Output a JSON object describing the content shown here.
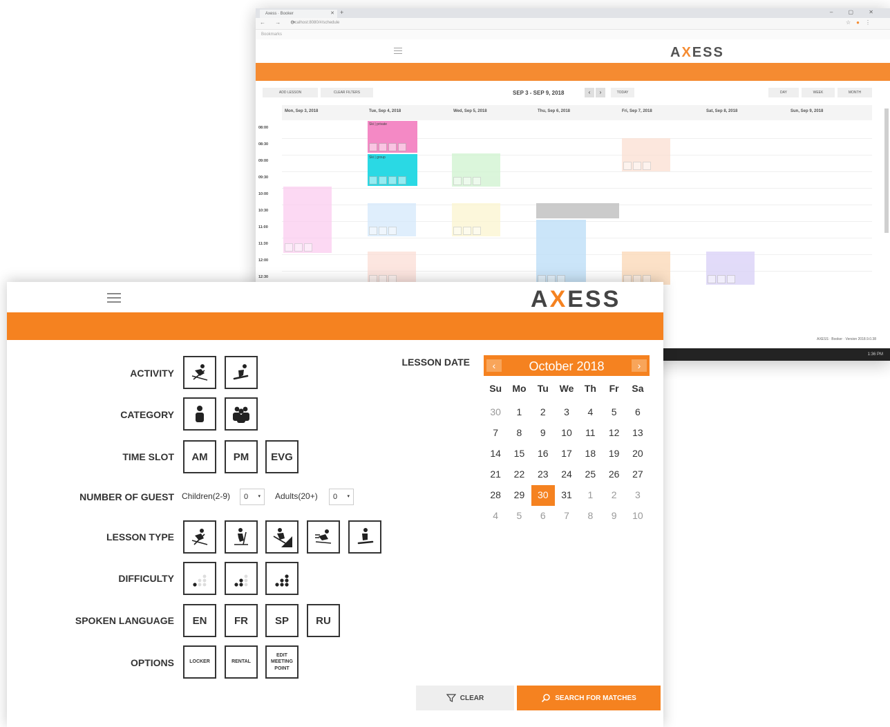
{
  "back_window": {
    "tab_title": "Axess · Booker",
    "url": "localhost:8080/#/schedule",
    "bookmark": "Bookmarks",
    "logo": "AXESS",
    "toolbar": {
      "add_label": "ADD LESSON",
      "clear_label": "CLEAR FILTERS",
      "range": "SEP 3 - SEP 9, 2018",
      "today": "TODAY",
      "day": "DAY",
      "week": "WEEK",
      "month": "MONTH"
    },
    "days": [
      "Mon, Sep 3, 2018",
      "Tue, Sep 4, 2018",
      "Wed, Sep 5, 2018",
      "Thu, Sep 6, 2018",
      "Fri, Sep 7, 2018",
      "Sat, Sep 8, 2018",
      "Sun, Sep 9, 2018"
    ],
    "times": [
      "08:00",
      "08:30",
      "09:00",
      "09:30",
      "10:00",
      "10:30",
      "11:00",
      "11:30",
      "12:00",
      "12:30"
    ],
    "appointments": [
      {
        "title": "Ski | private",
        "color": "#f47fc1"
      },
      {
        "title": "Ski | group",
        "color": "#18d6e2"
      }
    ],
    "footer": "AXESS · Booker · Version 2018.9.0.38",
    "taskbar_time": "1:36 PM"
  },
  "front_window": {
    "logo": "AXESS",
    "labels": {
      "activity": "ACTIVITY",
      "category": "CATEGORY",
      "time_slot": "TIME SLOT",
      "number_of_guest": "NUMBER OF GUEST",
      "lesson_type": "LESSON TYPE",
      "difficulty": "DIFFICULTY",
      "spoken_language": "SPOKEN LANGUAGE",
      "options": "OPTIONS",
      "lesson_date": "LESSON DATE"
    },
    "activity_icons": [
      "ski-icon",
      "snowboard-icon"
    ],
    "category_icons": [
      "single-person-icon",
      "group-icon"
    ],
    "time_slots": [
      "AM",
      "PM",
      "EVG"
    ],
    "guests": {
      "children_label": "Children(2-9)",
      "children_value": "0",
      "adults_label": "Adults(20+)",
      "adults_value": "0"
    },
    "lesson_type_icons": [
      "ski-downhill-icon",
      "cross-country-icon",
      "freestyle-icon",
      "racing-icon",
      "snowboard-trick-icon"
    ],
    "difficulty_icons": [
      "difficulty-beginner-icon",
      "difficulty-intermediate-icon",
      "difficulty-advanced-icon"
    ],
    "languages": [
      "EN",
      "FR",
      "SP",
      "RU"
    ],
    "options": [
      "LOCKER",
      "RENTAL",
      "EDIT MEETING POINT"
    ],
    "calendar": {
      "month": "October 2018",
      "prev": "‹",
      "next": "›",
      "dow": [
        "Su",
        "Mo",
        "Tu",
        "We",
        "Th",
        "Fr",
        "Sa"
      ],
      "days": [
        "30",
        "1",
        "2",
        "3",
        "4",
        "5",
        "6",
        "7",
        "8",
        "9",
        "10",
        "11",
        "12",
        "13",
        "14",
        "15",
        "16",
        "17",
        "18",
        "19",
        "20",
        "21",
        "22",
        "23",
        "24",
        "25",
        "26",
        "27",
        "28",
        "29",
        "30",
        "31",
        "1",
        "2",
        "3",
        "4",
        "5",
        "6",
        "7",
        "8",
        "9",
        "10"
      ],
      "muted_indices": [
        0,
        32,
        33,
        34,
        35,
        36,
        37,
        38,
        39,
        40,
        41
      ],
      "selected_index": 30,
      "accent": "#f58220"
    },
    "clear_label": "CLEAR",
    "search_label": "SEARCH FOR MATCHES"
  }
}
